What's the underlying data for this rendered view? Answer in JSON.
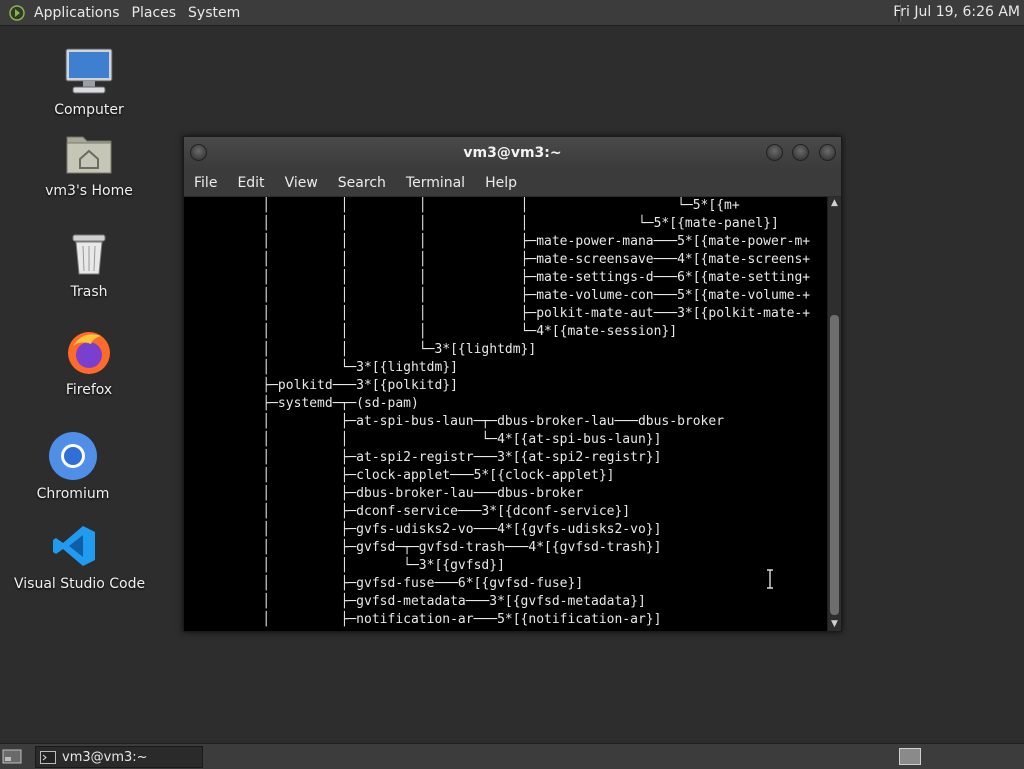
{
  "top_panel": {
    "menus": [
      "Applications",
      "Places",
      "System"
    ],
    "clock": "Fri Jul 19,  6:26 AM"
  },
  "desktop_icons": [
    {
      "label": "Computer",
      "icon": "computer-icon"
    },
    {
      "label": "vm3's Home",
      "icon": "home-folder-icon"
    },
    {
      "label": "Trash",
      "icon": "trash-icon"
    },
    {
      "label": "Firefox",
      "icon": "firefox-icon"
    },
    {
      "label": "Chromium",
      "icon": "chromium-icon"
    },
    {
      "label": "Visual Studio Code",
      "icon": "vscode-icon"
    }
  ],
  "window": {
    "title": "vm3@vm3:~",
    "menu": [
      "File",
      "Edit",
      "View",
      "Search",
      "Terminal",
      "Help"
    ]
  },
  "terminal": {
    "lines": [
      "          │         │         │            │                   └─5*[{m+",
      "          │         │         │            │              └─5*[{mate-panel}]",
      "          │         │         │            ├─mate-power-mana───5*[{mate-power-m+",
      "          │         │         │            ├─mate-screensave───4*[{mate-screens+",
      "          │         │         │            ├─mate-settings-d───6*[{mate-setting+",
      "          │         │         │            ├─mate-volume-con───5*[{mate-volume-+",
      "          │         │         │            ├─polkit-mate-aut───3*[{polkit-mate-+",
      "          │         │         │            └─4*[{mate-session}]",
      "          │         │         └─3*[{lightdm}]",
      "          │         └─3*[{lightdm}]",
      "          ├─polkitd───3*[{polkitd}]",
      "          ├─systemd─┬─(sd-pam)",
      "          │         ├─at-spi-bus-laun─┬─dbus-broker-lau───dbus-broker",
      "          │         │                 └─4*[{at-spi-bus-laun}]",
      "          │         ├─at-spi2-registr───3*[{at-spi2-registr}]",
      "          │         ├─clock-applet───5*[{clock-applet}]",
      "          │         ├─dbus-broker-lau───dbus-broker",
      "          │         ├─dconf-service───3*[{dconf-service}]",
      "          │         ├─gvfs-udisks2-vo───4*[{gvfs-udisks2-vo}]",
      "          │         ├─gvfsd─┬─gvfsd-trash───4*[{gvfsd-trash}]",
      "          │         │       └─3*[{gvfsd}]",
      "          │         ├─gvfsd-fuse───6*[{gvfsd-fuse}]",
      "          │         ├─gvfsd-metadata───3*[{gvfsd-metadata}]",
      "          │         ├─notification-ar───5*[{notification-ar}]"
    ]
  },
  "taskbar": {
    "tasks": [
      {
        "label": "vm3@vm3:~"
      }
    ]
  }
}
